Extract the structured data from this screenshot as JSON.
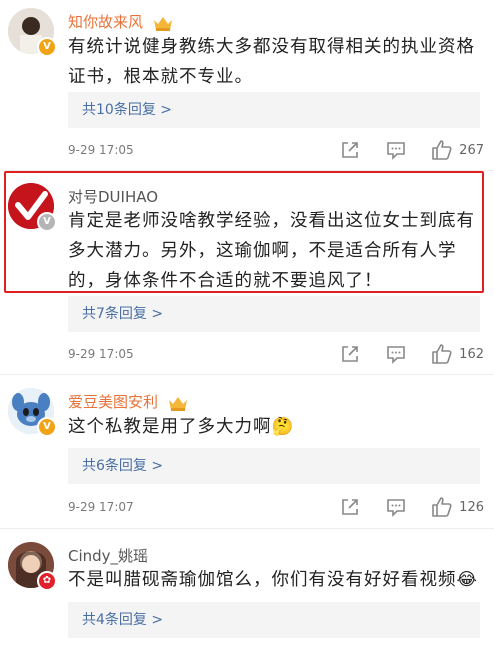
{
  "comments": [
    {
      "username": "知你故来风",
      "text": "有统计说健身教练大多都没有取得相关的执业资格证书，根本就不专业。",
      "replies": "共10条回复 >",
      "time": "9-29 17:05",
      "likes": "267",
      "avatar_color": "#d9d2c9"
    },
    {
      "username": "对号DUIHAO",
      "text": "肯定是老师没啥教学经验，没看出这位女士到底有多大潜力。另外，这瑜伽啊，不是适合所有人学的，身体条件不合适的就不要追风了！",
      "replies": "共7条回复 >",
      "time": "9-29 17:05",
      "likes": "162",
      "avatar_color": "#c5141b"
    },
    {
      "username": "爱豆美图安利",
      "text": "这个私教是用了多大力啊🤔",
      "replies": "共6条回复 >",
      "time": "9-29 17:07",
      "likes": "126",
      "avatar_color": "#6fa8dc"
    },
    {
      "username": "Cindy_姚瑶",
      "text": "不是叫腊砚斋瑜伽馆么，你们有没有好好看视频😂",
      "replies": "共4条回复 >",
      "avatar_color": "#b08070"
    }
  ],
  "colors": {
    "highlight": "#e02020",
    "username": "#e8733a",
    "reply_link": "#4a6fa5"
  }
}
